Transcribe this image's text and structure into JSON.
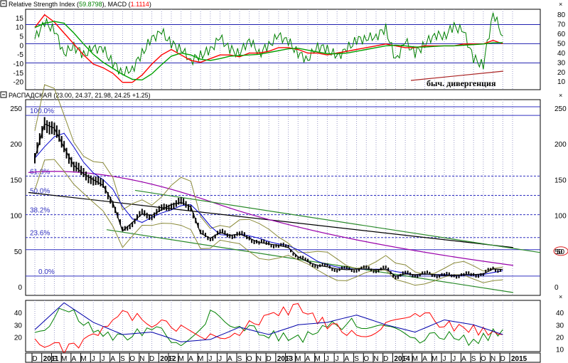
{
  "panels": {
    "top": {
      "title_prefix": "Relative Strength Index (",
      "rsi_value": "59.8798",
      "title_mid": "), MACD (",
      "macd_value": "1.1114",
      "title_suffix": ")",
      "annotation": "быч. дивергенция",
      "close_label": "×"
    },
    "main": {
      "title": "РАСПАДСКАЯ (23.00, 24.37, 21.98, 24.25 +1.25)",
      "close_label": "×",
      "marker": "50"
    },
    "bottom": {
      "close_label": "×"
    }
  },
  "colors": {
    "price": "#000000",
    "rsi": "#008000",
    "macd": "#ff0000",
    "fib_lines": "#3030c0",
    "bands": "#8b8b3a",
    "ma_long": "#000000",
    "ma_mid": "#9900aa",
    "channel": "#2a8a2a",
    "divergence": "#aa2222",
    "dmi_plus": "#008000",
    "dmi_minus": "#ff0000",
    "adx": "#0000aa",
    "marker_ring": "#dd2222"
  },
  "chart_data": [
    {
      "type": "line",
      "panel": "RSI / MACD",
      "left_ticks": [
        15,
        10,
        5,
        0,
        -5,
        -10,
        -15,
        -20
      ],
      "right_ticks": [
        80,
        70,
        60,
        50,
        40,
        30,
        20,
        10
      ],
      "levels_right_scale": [
        70,
        50,
        30
      ],
      "series": [
        {
          "name": "Relative Strength Index",
          "scale": "right",
          "x": [
            "2010-12",
            "2011-01",
            "2011-02",
            "2011-03",
            "2011-04",
            "2011-05",
            "2011-06",
            "2011-07",
            "2011-08",
            "2011-09",
            "2011-10",
            "2011-11",
            "2011-12",
            "2012-01",
            "2012-02",
            "2012-03",
            "2012-04",
            "2012-05",
            "2012-06",
            "2012-07",
            "2012-08",
            "2012-09",
            "2012-10",
            "2012-11",
            "2012-12",
            "2013-01",
            "2013-02",
            "2013-03",
            "2013-04",
            "2013-05",
            "2013-06",
            "2013-07",
            "2013-08",
            "2013-09",
            "2013-10",
            "2013-11",
            "2013-12",
            "2014-01",
            "2014-02",
            "2014-03",
            "2014-04",
            "2014-05",
            "2014-06",
            "2014-07",
            "2014-08",
            "2014-09",
            "2014-10",
            "2014-11",
            "2014-12"
          ],
          "values": [
            55,
            72,
            65,
            40,
            48,
            38,
            45,
            44,
            30,
            20,
            24,
            40,
            55,
            62,
            50,
            45,
            33,
            38,
            43,
            56,
            44,
            40,
            55,
            40,
            48,
            58,
            52,
            40,
            34,
            48,
            44,
            36,
            44,
            54,
            56,
            58,
            66,
            32,
            52,
            40,
            50,
            60,
            58,
            68,
            62,
            34,
            28,
            83,
            58
          ]
        },
        {
          "name": "MACD",
          "scale": "left",
          "x": [
            "2010-12",
            "2011-01",
            "2011-02",
            "2011-03",
            "2011-04",
            "2011-05",
            "2011-06",
            "2011-07",
            "2011-08",
            "2011-09",
            "2011-10",
            "2011-11",
            "2011-12",
            "2012-01",
            "2012-02",
            "2012-03",
            "2012-04",
            "2012-05",
            "2012-06",
            "2012-07",
            "2012-08",
            "2012-09",
            "2012-10",
            "2012-11",
            "2012-12",
            "2013-01",
            "2013-02",
            "2013-03",
            "2013-04",
            "2013-05",
            "2013-06",
            "2013-07",
            "2013-08",
            "2013-09",
            "2013-10",
            "2013-11",
            "2013-12",
            "2014-01",
            "2014-02",
            "2014-03",
            "2014-04",
            "2014-05",
            "2014-06",
            "2014-07",
            "2014-08",
            "2014-09",
            "2014-10",
            "2014-11",
            "2014-12"
          ],
          "values": [
            10,
            17,
            13,
            7,
            1,
            -5,
            -10,
            -12,
            -15,
            -20,
            -20,
            -16,
            -10,
            -5,
            -2,
            -5,
            -8,
            -9,
            -7,
            -5,
            -5,
            -6,
            -4,
            -4,
            -3,
            -1,
            -1,
            -2,
            -4,
            -4,
            -5,
            -4,
            -3,
            -2,
            -1,
            0,
            1,
            0,
            -1,
            -1,
            0,
            0,
            0,
            0,
            1,
            1,
            1,
            3,
            1.1
          ]
        }
      ]
    },
    {
      "type": "line",
      "panel": "РАСПАДСКАЯ",
      "left_ticks": [
        250,
        200,
        150,
        100,
        50,
        0
      ],
      "right_ticks": [
        250,
        200,
        150,
        100,
        50,
        0
      ],
      "fibonacci_labels": [
        "100.0%",
        "61.8%",
        "50.0%",
        "38.2%",
        "23.6%",
        "0.0%"
      ],
      "fibonacci_levels": [
        240,
        155,
        128,
        101,
        69,
        15
      ],
      "extra_levels": [
        252,
        52
      ],
      "series": [
        {
          "name": "",
          "x": [
            "2010-12",
            "2011-01",
            "2011-02",
            "2011-03",
            "2011-04",
            "2011-05",
            "2011-06",
            "2011-07",
            "2011-08",
            "2011-09",
            "2011-10",
            "2011-11",
            "2011-12",
            "2012-01",
            "2012-02",
            "2012-03",
            "2012-04",
            "2012-05",
            "2012-06",
            "2012-07",
            "2012-08",
            "2012-09",
            "2012-10",
            "2012-11",
            "2012-12",
            "2013-01",
            "2013-02",
            "2013-03",
            "2013-04",
            "2013-05",
            "2013-06",
            "2013-07",
            "2013-08",
            "2013-09",
            "2013-10",
            "2013-11",
            "2013-12",
            "2014-01",
            "2014-02",
            "2014-03",
            "2014-04",
            "2014-05",
            "2014-06",
            "2014-07",
            "2014-08",
            "2014-09",
            "2014-10",
            "2014-11",
            "2014-12"
          ],
          "values": [
            180,
            228,
            222,
            195,
            170,
            158,
            150,
            142,
            118,
            78,
            90,
            102,
            100,
            108,
            115,
            118,
            112,
            75,
            68,
            76,
            72,
            74,
            68,
            62,
            60,
            58,
            55,
            42,
            35,
            30,
            28,
            25,
            24,
            25,
            25,
            24,
            25,
            15,
            18,
            17,
            18,
            17,
            16,
            16,
            17,
            17,
            18,
            25,
            24.25
          ]
        }
      ]
    },
    {
      "type": "line",
      "panel": "DMI",
      "left_ticks": [
        40,
        30,
        20
      ],
      "right_ticks": [
        40,
        30,
        20,
        10
      ],
      "series": [
        {
          "name": "",
          "x": [
            "2010-12",
            "2011-03",
            "2011-06",
            "2011-09",
            "2011-12",
            "2012-03",
            "2012-06",
            "2012-09",
            "2012-12",
            "2013-03",
            "2013-06",
            "2013-09",
            "2013-12",
            "2014-03",
            "2014-06",
            "2014-09",
            "2014-12"
          ],
          "values": [
            20,
            45,
            25,
            18,
            28,
            15,
            38,
            30,
            22,
            18,
            28,
            32,
            26,
            18,
            22,
            16,
            26
          ]
        },
        {
          "name": "",
          "x": [
            "2010-12",
            "2011-03",
            "2011-06",
            "2011-09",
            "2011-12",
            "2012-03",
            "2012-06",
            "2012-09",
            "2012-12",
            "2013-03",
            "2013-06",
            "2013-09",
            "2013-12",
            "2014-03",
            "2014-06",
            "2014-09",
            "2014-12"
          ],
          "values": [
            18,
            10,
            20,
            40,
            32,
            28,
            20,
            25,
            38,
            44,
            30,
            22,
            28,
            42,
            30,
            26,
            22
          ]
        },
        {
          "name": "",
          "x": [
            "2010-12",
            "2011-03",
            "2011-06",
            "2011-09",
            "2011-12",
            "2012-03",
            "2012-06",
            "2012-09",
            "2012-12",
            "2013-03",
            "2013-06",
            "2013-09",
            "2013-12",
            "2014-03",
            "2014-06",
            "2014-09",
            "2014-12"
          ],
          "values": [
            26,
            48,
            32,
            22,
            24,
            16,
            18,
            28,
            22,
            30,
            32,
            38,
            30,
            24,
            34,
            30,
            22
          ]
        }
      ]
    }
  ],
  "time_axis": {
    "months": [
      "D",
      "2011",
      "F",
      "M",
      "A",
      "M",
      "J",
      "J",
      "A",
      "S",
      "O",
      "N",
      "D",
      "2012",
      "F",
      "M",
      "A",
      "M",
      "J",
      "J",
      "A",
      "S",
      "O",
      "N",
      "D",
      "2013",
      "F",
      "M",
      "A",
      "M",
      "J",
      "J",
      "A",
      "S",
      "O",
      "N",
      "D",
      "2014",
      "F",
      "M",
      "A",
      "M",
      "J",
      "J",
      "A",
      "S",
      "O",
      "N",
      "D",
      "2015"
    ]
  }
}
